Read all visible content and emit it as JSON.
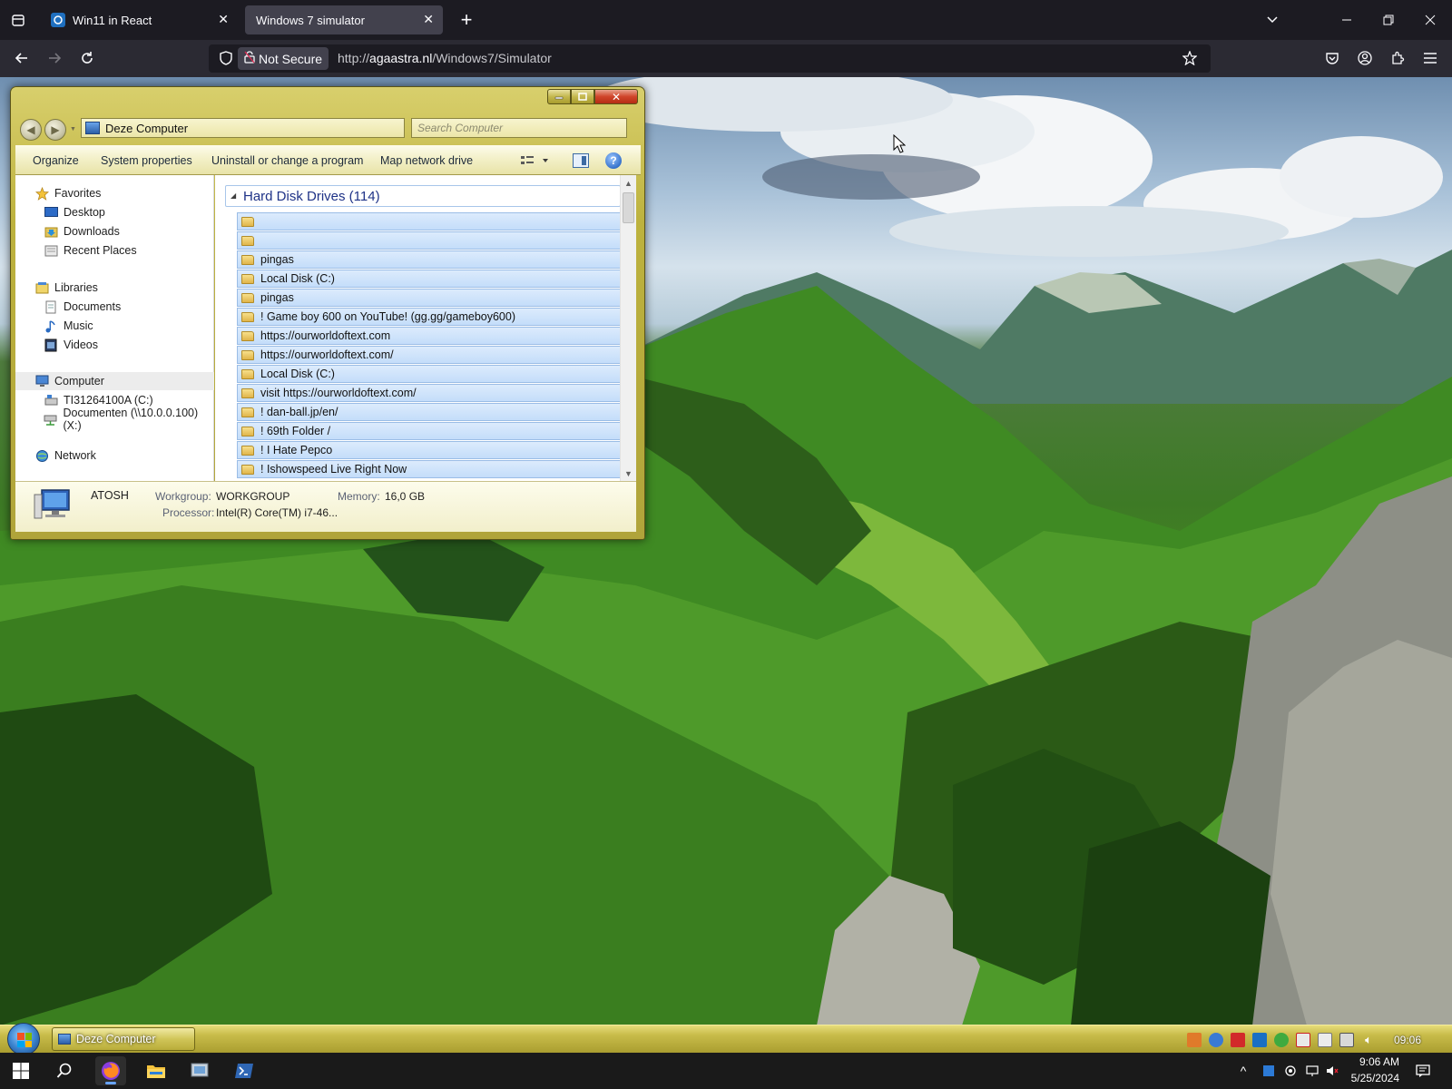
{
  "browser": {
    "tabs": [
      {
        "title": "Win11 in React",
        "active": false
      },
      {
        "title": "Windows 7 simulator",
        "active": true
      }
    ],
    "security_label": "Not Secure",
    "url_prefix": "http://",
    "url_host": "agaastra.nl",
    "url_path": "/Windows7/Simulator"
  },
  "explorer": {
    "address": "Deze Computer",
    "search_placeholder": "Search Computer",
    "toolbar": {
      "organize": "Organize",
      "system_properties": "System properties",
      "uninstall": "Uninstall or change a program",
      "map_drive": "Map network drive"
    },
    "nav": {
      "favorites": "Favorites",
      "desktop": "Desktop",
      "downloads": "Downloads",
      "recent": "Recent Places",
      "libraries": "Libraries",
      "documents": "Documents",
      "music": "Music",
      "videos": "Videos",
      "computer": "Computer",
      "drive_c": "TI31264100A (C:)",
      "drive_x": "Documenten (\\\\10.0.0.100) (X:)",
      "network": "Network"
    },
    "group_header": "Hard Disk Drives (114)",
    "items": [
      "",
      "",
      "pingas",
      "Local Disk (C:)",
      "pingas",
      "! Game boy 600 on YouTube! (gg.gg/gameboy600)",
      "https://ourworldoftext.com",
      "https://ourworldoftext.com/",
      "Local Disk (C:)",
      "visit https://ourworldoftext.com/",
      "! dan-ball.jp/en/",
      "! 69th Folder /",
      "! I Hate Pepco",
      "! Ishowspeed Live Right Now"
    ],
    "details": {
      "computer_name": "ATOSH",
      "workgroup_label": "Workgroup:",
      "workgroup_value": "WORKGROUP",
      "memory_label": "Memory:",
      "memory_value": "16,0 GB",
      "processor_label": "Processor:",
      "processor_value": "Intel(R) Core(TM) i7-46..."
    }
  },
  "win7_taskbar": {
    "task_label": "Deze Computer",
    "clock": "09:06"
  },
  "host_taskbar": {
    "time": "9:06 AM",
    "date": "5/25/2024"
  },
  "colors": {
    "window_frame": "#bdb23e",
    "selection_blue": "#c4ddfa",
    "browser_bg": "#1c1b22"
  }
}
